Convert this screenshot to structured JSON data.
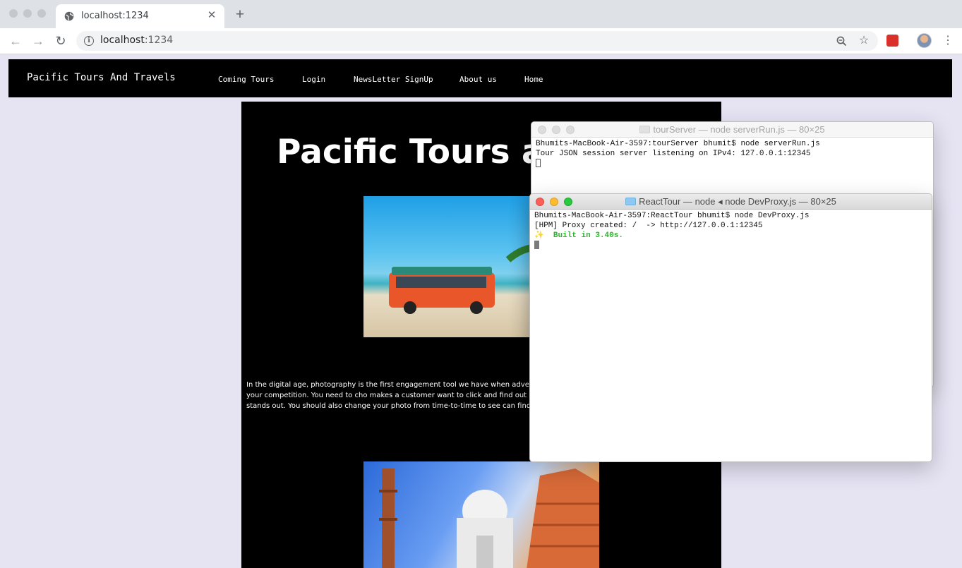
{
  "browser": {
    "tab_title": "localhost:1234",
    "url_host": "localhost",
    "url_port": ":1234",
    "icons": [
      "globe-icon",
      "close-icon",
      "plus-icon",
      "back-icon",
      "forward-icon",
      "reload-icon",
      "info-icon",
      "zoom-icon",
      "star-icon",
      "extension-icon",
      "avatar",
      "more-icon"
    ]
  },
  "site": {
    "brand": "Pacific Tours And Travels",
    "nav": [
      "Coming Tours",
      "Login",
      "NewsLetter SignUp",
      "About us",
      "Home"
    ],
    "hero_title": "Pacific Tours an",
    "body_text": "In the digital age, photography is the first engagement tool we have when advert website user, and what will set you apart from your competition. You need to cho makes a customer want to click and find out more. Look at what your competitors your tour stands out. You should also change your photo from time-to-time to see can find which one works best"
  },
  "terminals": {
    "server": {
      "title": "tourServer — node serverRun.js — 80×25",
      "lines": [
        "Bhumits-MacBook-Air-3597:tourServer bhumit$ node serverRun.js",
        "Tour JSON session server listening on IPv4: 127.0.0.1:12345"
      ]
    },
    "react": {
      "title": "ReactTour — node ◂ node DevProxy.js — 80×25",
      "lines": [
        "Bhumits-MacBook-Air-3597:ReactTour bhumit$ node DevProxy.js",
        "[HPM] Proxy created: /  -> http://127.0.0.1:12345"
      ],
      "sparkle": "✨",
      "built": "Built in 3.40s."
    }
  },
  "colors": {
    "page_bg": "#e6e3f3",
    "site_black": "#000000",
    "built_green": "#2cb52c",
    "close_red": "#fc5f57",
    "minimize_yellow": "#fdbc2e",
    "zoom_green": "#28c840"
  }
}
